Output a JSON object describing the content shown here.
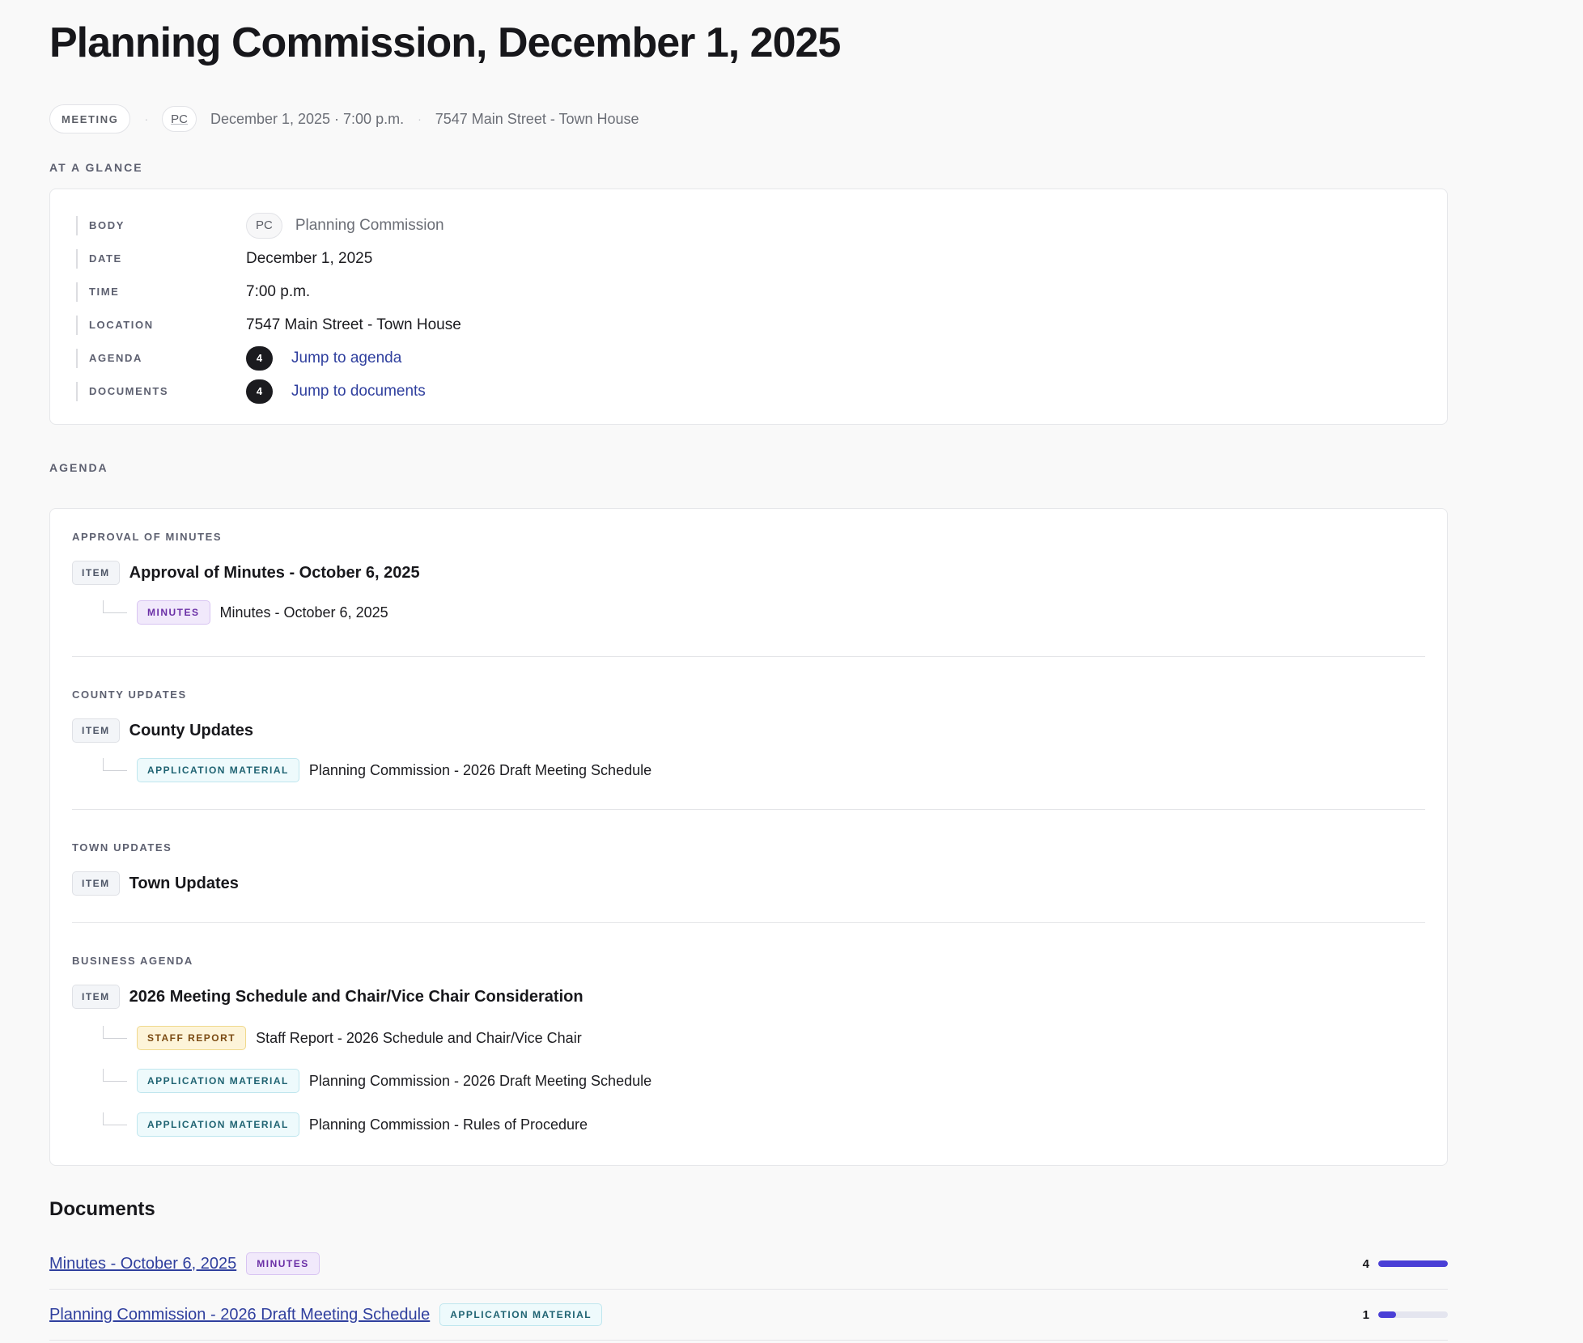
{
  "meeting": {
    "title": "Planning Commission, December 1, 2025",
    "type_label": "MEETING",
    "body_abbr": "PC",
    "datetime": "December 1, 2025 · 7:00 p.m.",
    "location": "7547 Main Street - Town House"
  },
  "at_a_glance": {
    "section_label": "AT A GLANCE",
    "rows": {
      "body": {
        "key": "BODY",
        "abbr": "PC",
        "value": "Planning Commission"
      },
      "date": {
        "key": "DATE",
        "value": "December 1, 2025"
      },
      "time": {
        "key": "TIME",
        "value": "7:00 p.m."
      },
      "location": {
        "key": "LOCATION",
        "value": "7547 Main Street - Town House"
      },
      "agenda": {
        "key": "AGENDA",
        "count": "4",
        "link": "Jump to agenda"
      },
      "documents": {
        "key": "DOCUMENTS",
        "count": "4",
        "link": "Jump to documents"
      }
    }
  },
  "agenda": {
    "section_label": "AGENDA",
    "item_tag": "ITEM",
    "groups": [
      {
        "title": "APPROVAL OF MINUTES",
        "item": "Approval of Minutes - October 6, 2025",
        "subs": [
          {
            "tag": "MINUTES",
            "title": "Minutes - October 6, 2025"
          }
        ]
      },
      {
        "title": "COUNTY UPDATES",
        "item": "County Updates",
        "subs": [
          {
            "tag": "APPLICATION MATERIAL",
            "title": "Planning Commission - 2026 Draft Meeting Schedule"
          }
        ]
      },
      {
        "title": "TOWN UPDATES",
        "item": "Town Updates",
        "subs": []
      },
      {
        "title": "BUSINESS AGENDA",
        "item": "2026 Meeting Schedule and Chair/Vice Chair Consideration",
        "subs": [
          {
            "tag": "STAFF REPORT",
            "title": "Staff Report - 2026 Schedule and Chair/Vice Chair"
          },
          {
            "tag": "APPLICATION MATERIAL",
            "title": "Planning Commission - 2026 Draft Meeting Schedule"
          },
          {
            "tag": "APPLICATION MATERIAL",
            "title": "Planning Commission - Rules of Procedure"
          }
        ]
      }
    ]
  },
  "documents": {
    "heading": "Documents",
    "rows": [
      {
        "title": "Minutes - October 6, 2025",
        "tag": "MINUTES",
        "count": "4",
        "fill_fraction": 1.0
      },
      {
        "title": "Planning Commission - 2026 Draft Meeting Schedule",
        "tag": "APPLICATION MATERIAL",
        "count": "1",
        "fill_fraction": 0.25
      }
    ]
  },
  "colors": {
    "link": "#2f3f9e",
    "bar_fill": "#4a3fd6",
    "minutes_tag": "#6a2fa6",
    "application_material_tag": "#1f6372",
    "staff_report_tag": "#7b4a12"
  }
}
